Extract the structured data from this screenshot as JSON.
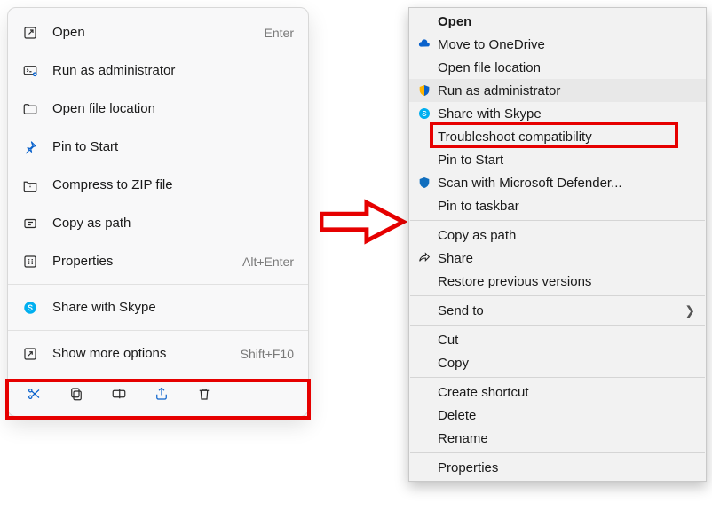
{
  "menu11": {
    "items": [
      {
        "label": "Open",
        "hint": "Enter",
        "icon": "open-icon"
      },
      {
        "label": "Run as administrator",
        "hint": "",
        "icon": "admin-icon"
      },
      {
        "label": "Open file location",
        "hint": "",
        "icon": "folder-icon"
      },
      {
        "label": "Pin to Start",
        "hint": "",
        "icon": "pin-icon"
      },
      {
        "label": "Compress to ZIP file",
        "hint": "",
        "icon": "zip-icon"
      },
      {
        "label": "Copy as path",
        "hint": "",
        "icon": "copy-path-icon"
      },
      {
        "label": "Properties",
        "hint": "Alt+Enter",
        "icon": "properties-icon"
      }
    ],
    "share": {
      "label": "Share with Skype",
      "icon": "skype-icon"
    },
    "more": {
      "label": "Show more options",
      "hint": "Shift+F10",
      "icon": "more-options-icon"
    },
    "iconbar": [
      "cut-icon",
      "copy-icon",
      "rename-icon",
      "share-icon",
      "delete-icon"
    ]
  },
  "menu10": {
    "groups": [
      [
        {
          "label": "Open",
          "bold": true
        },
        {
          "label": "Move to OneDrive",
          "icon": "onedrive-icon"
        },
        {
          "label": "Open file location"
        },
        {
          "label": "Run as administrator",
          "icon": "shield-icon",
          "hovered": true
        },
        {
          "label": "Share with Skype",
          "icon": "skype-icon"
        },
        {
          "label": "Troubleshoot compatibility",
          "highlight": true
        },
        {
          "label": "Pin to Start"
        },
        {
          "label": "Scan with Microsoft Defender...",
          "icon": "defender-icon"
        },
        {
          "label": "Pin to taskbar"
        }
      ],
      [
        {
          "label": "Copy as path"
        },
        {
          "label": "Share",
          "icon": "share-out-icon"
        },
        {
          "label": "Restore previous versions"
        }
      ],
      [
        {
          "label": "Send to",
          "submenu": true
        }
      ],
      [
        {
          "label": "Cut"
        },
        {
          "label": "Copy"
        }
      ],
      [
        {
          "label": "Create shortcut"
        },
        {
          "label": "Delete"
        },
        {
          "label": "Rename"
        }
      ],
      [
        {
          "label": "Properties"
        }
      ]
    ]
  }
}
